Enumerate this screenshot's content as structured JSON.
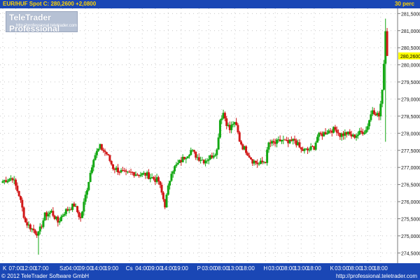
{
  "header": {
    "symbol_line": "EUR/HUF Spot C: 280,2600 +2,0800",
    "timeframe": "30 perc"
  },
  "logo": {
    "brand": "TeleTrader Professional",
    "url": "http://professional.teletrader.com"
  },
  "footer": {
    "copyright": "© 2012 TeleTrader Software GmbH",
    "url": "http://professional.teletrader.com"
  },
  "colors": {
    "up": "#13a813",
    "down": "#d11818",
    "header_bg": "#1a47b5",
    "header_text": "#ffd400",
    "price_marker": "#ffff00"
  },
  "chart_data": {
    "type": "candlestick",
    "title": "EUR/HUF Spot",
    "last_price": 280.26,
    "change": 2.08,
    "last_price_label": "280,2600",
    "ylim": [
      274.2,
      281.65
    ],
    "grid": true,
    "y_ticks": [
      "274,5000",
      "275,0000",
      "275,5000",
      "276,0000",
      "276,5000",
      "277,0000",
      "277,5000",
      "278,0000",
      "278,5000",
      "279,0000",
      "279,5000",
      "280,0000",
      "280,5000",
      "281,0000",
      "281,5000"
    ],
    "y_tick_values": [
      274.5,
      275.0,
      275.5,
      276.0,
      276.5,
      277.0,
      277.5,
      278.0,
      278.5,
      279.0,
      279.5,
      280.0,
      280.5,
      281.0,
      281.5
    ],
    "x_ticks": [
      "K",
      "07:00",
      "12:00",
      "17:00",
      "Sz",
      "04:00",
      "09:00",
      "14:00",
      "19:00",
      "Cs",
      "04:00",
      "09:00",
      "14:00",
      "19:00",
      "P",
      "03:00",
      "08:00",
      "13:00",
      "18:00",
      "H",
      "03:00",
      "08:00",
      "13:00",
      "18:00",
      "K",
      "03:00",
      "08:00",
      "13:00",
      "18:00"
    ],
    "x_tick_slots": [
      0,
      8,
      16,
      24,
      37,
      43,
      51,
      59,
      67,
      78,
      86,
      94,
      102,
      110,
      121,
      127,
      135,
      143,
      151,
      162,
      168,
      176,
      184,
      192,
      203,
      209,
      217,
      225,
      233
    ],
    "num_slots": 241,
    "knots": [
      [
        0,
        276.6
      ],
      [
        6,
        276.7
      ],
      [
        10,
        276.2
      ],
      [
        14,
        275.4
      ],
      [
        18,
        275.2
      ],
      [
        22,
        275.05
      ],
      [
        26,
        275.6
      ],
      [
        30,
        275.7
      ],
      [
        34,
        275.4
      ],
      [
        38,
        275.7
      ],
      [
        44,
        275.9
      ],
      [
        48,
        275.5
      ],
      [
        52,
        276.4
      ],
      [
        56,
        277.3
      ],
      [
        60,
        277.6
      ],
      [
        64,
        277.4
      ],
      [
        68,
        277.0
      ],
      [
        72,
        276.9
      ],
      [
        76,
        276.8
      ],
      [
        80,
        276.85
      ],
      [
        84,
        276.8
      ],
      [
        88,
        276.8
      ],
      [
        92,
        276.7
      ],
      [
        96,
        276.6
      ],
      [
        100,
        275.9
      ],
      [
        104,
        276.9
      ],
      [
        108,
        277.1
      ],
      [
        112,
        277.3
      ],
      [
        116,
        277.5
      ],
      [
        120,
        277.3
      ],
      [
        124,
        277.2
      ],
      [
        128,
        277.3
      ],
      [
        132,
        277.5
      ],
      [
        134,
        278.4
      ],
      [
        136,
        278.6
      ],
      [
        138,
        278.3
      ],
      [
        140,
        278.1
      ],
      [
        142,
        278.3
      ],
      [
        144,
        278.2
      ],
      [
        146,
        277.8
      ],
      [
        148,
        277.6
      ],
      [
        150,
        277.5
      ],
      [
        154,
        277.2
      ],
      [
        158,
        277.1
      ],
      [
        162,
        277.2
      ],
      [
        164,
        277.7
      ],
      [
        168,
        277.7
      ],
      [
        172,
        277.8
      ],
      [
        176,
        277.7
      ],
      [
        180,
        277.8
      ],
      [
        184,
        277.5
      ],
      [
        188,
        277.5
      ],
      [
        192,
        277.6
      ],
      [
        194,
        277.9
      ],
      [
        198,
        278.0
      ],
      [
        202,
        278.1
      ],
      [
        206,
        278.1
      ],
      [
        208,
        277.95
      ],
      [
        212,
        278.0
      ],
      [
        216,
        277.9
      ],
      [
        220,
        278.0
      ],
      [
        224,
        278.1
      ],
      [
        226,
        278.4
      ],
      [
        228,
        278.7
      ],
      [
        230,
        278.6
      ],
      [
        232,
        278.5
      ],
      [
        234,
        279.2
      ],
      [
        236,
        281.0
      ],
      [
        237,
        280.26
      ]
    ]
  }
}
